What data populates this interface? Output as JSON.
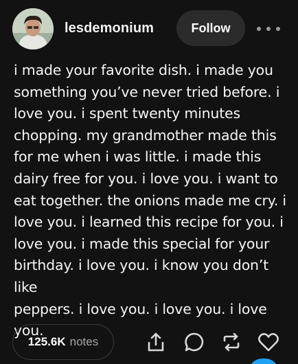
{
  "header": {
    "username": "lesdemonium",
    "follow_label": "Follow"
  },
  "post": {
    "text": "i made your favorite dish. i made you\nsomething you’ve never tried before. i\nlove you. i spent twenty minutes\nchopping. my grandmother made this\nfor me when i was little. i made this\ndairy free for you. i love you. i want to\neat together. the onions made me cry. i\nlove you. i learned this recipe for you. i\nlove you. i made this special for your\nbirthday. i love you. i know you don’t like\npeppers. i love you. i love you. i love you."
  },
  "footer": {
    "notes_count": "125.6K",
    "notes_label": "notes"
  },
  "icons": [
    "more-icon",
    "share-icon",
    "reply-icon",
    "reblog-icon",
    "like-icon"
  ],
  "colors": {
    "background": "#121212",
    "accent": "#1da1f2"
  }
}
